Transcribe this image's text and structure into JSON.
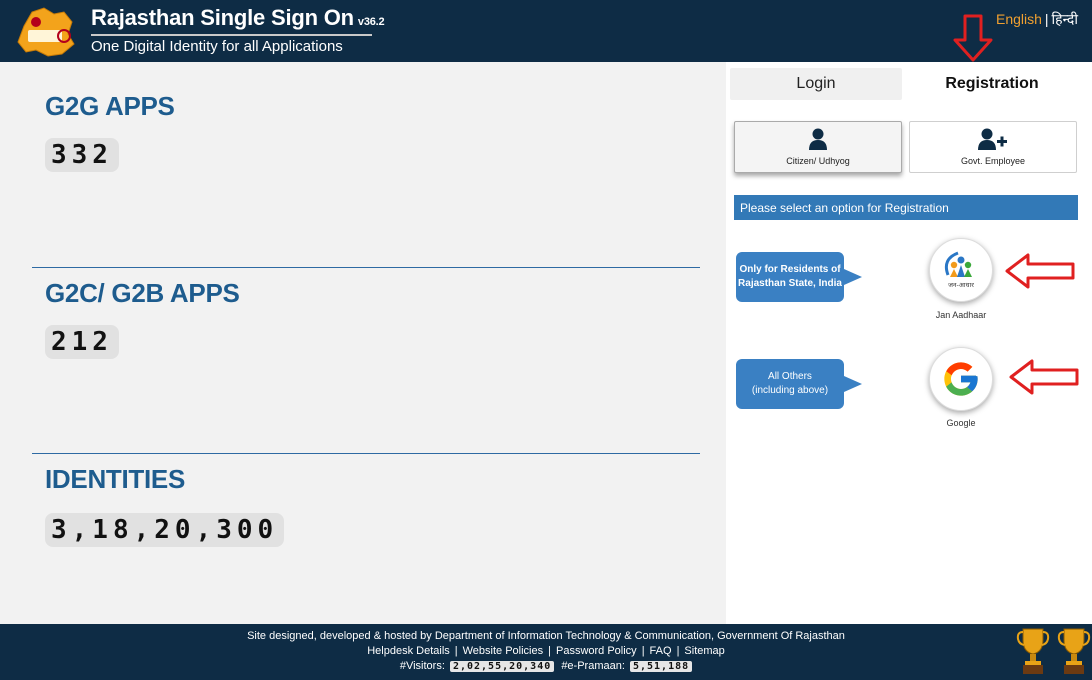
{
  "header": {
    "title": "Rajasthan Single Sign On",
    "version": "v36.2",
    "subtitle": "One Digital Identity for all Applications",
    "logo_text": "Rajasthan Single Sign On",
    "lang_english": "English",
    "lang_separator": "|",
    "lang_hindi": "हिन्दी"
  },
  "stats": {
    "g2g_title": "G2G APPS",
    "g2g_count": "332",
    "g2c_title": "G2C/ G2B APPS",
    "g2c_count": "212",
    "identities_title": "IDENTITIES",
    "identities_count": "3,18,20,300"
  },
  "auth": {
    "tab_login": "Login",
    "tab_registration": "Registration",
    "citizen_label": "Citizen/ Udhyog",
    "govt_label": "Govt. Employee",
    "instruction": "Please select an option for Registration",
    "option1_bubble": "Only for Residents of Rajasthan State, India",
    "option1_label": "Jan Aadhaar",
    "option2_bubble_line1": "All Others",
    "option2_bubble_line2": "(including above)",
    "option2_label": "Google",
    "jan_aadhaar_logo_text": "जन-आधार"
  },
  "footer": {
    "line1": "Site designed, developed & hosted by Department of Information Technology & Communication, Government Of Rajasthan",
    "links": [
      "Helpdesk Details",
      "Website Policies",
      "Password Policy",
      "FAQ",
      "Sitemap"
    ],
    "visitors_label": "#Visitors:",
    "visitors_count": "2,02,55,20,340",
    "epramaan_label": "#e-Pramaan:",
    "epramaan_count": "5,51,188"
  },
  "colors": {
    "header_bg": "#0e2c45",
    "accent_blue": "#1e5c8e",
    "instruction_bg": "#3279b7",
    "english_link": "#f0a030",
    "annotation_red": "#e02020"
  },
  "icons": [
    "user-icon",
    "user-plus-icon",
    "jan-aadhaar-logo",
    "google-logo",
    "trophy-icon",
    "red-arrow-icon"
  ]
}
